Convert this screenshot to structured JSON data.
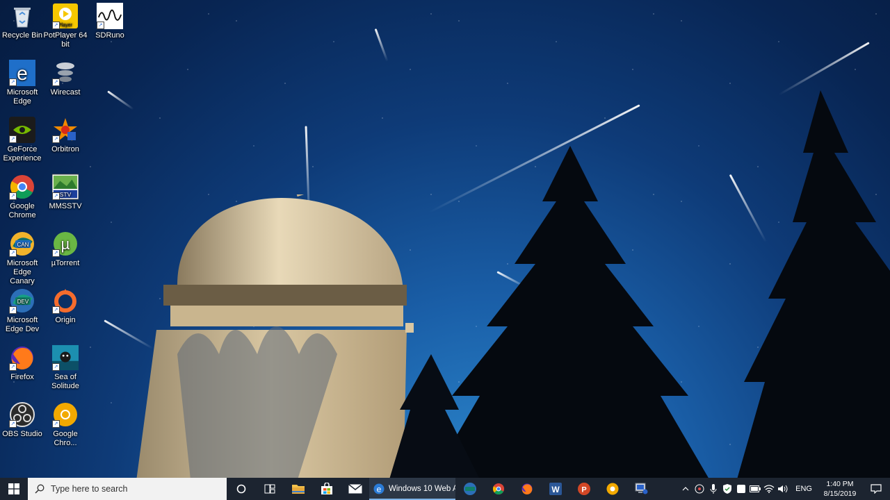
{
  "desktop_icons": [
    {
      "label": "Recycle Bin",
      "icon": "recycle-bin-icon"
    },
    {
      "label": "PotPlayer 64 bit",
      "icon": "potplayer-icon"
    },
    {
      "label": "SDRuno",
      "icon": "sdruno-icon"
    },
    {
      "label": "Microsoft Edge",
      "icon": "edge-icon"
    },
    {
      "label": "Wirecast",
      "icon": "wirecast-icon"
    },
    {
      "label": "GeForce Experience",
      "icon": "geforce-icon"
    },
    {
      "label": "Orbitron",
      "icon": "orbitron-icon"
    },
    {
      "label": "Google Chrome",
      "icon": "chrome-icon"
    },
    {
      "label": "MMSSTV",
      "icon": "mmsstv-icon"
    },
    {
      "label": "Microsoft Edge Canary",
      "icon": "edge-canary-icon"
    },
    {
      "label": "µTorrent",
      "icon": "utorrent-icon"
    },
    {
      "label": "Microsoft Edge Dev",
      "icon": "edge-dev-icon"
    },
    {
      "label": "Origin",
      "icon": "origin-icon"
    },
    {
      "label": "Firefox",
      "icon": "firefox-icon"
    },
    {
      "label": "Sea of Solitude",
      "icon": "sea-of-solitude-icon"
    },
    {
      "label": "OBS Studio",
      "icon": "obs-icon"
    },
    {
      "label": "Google Chro...",
      "icon": "chrome-canary-icon"
    }
  ],
  "taskbar": {
    "search_placeholder": "Type here to search",
    "active_window_label": "Windows 10 Web A...",
    "pinned": [
      "file-explorer-icon",
      "store-icon",
      "mail-icon",
      "edge-icon",
      "edge-dev-icon",
      "chrome-icon",
      "firefox-icon",
      "word-icon",
      "powerpoint-icon",
      "chrome-canary-icon",
      "network-app-icon"
    ],
    "language": "ENG",
    "time": "1:40 PM",
    "date": "8/15/2019"
  },
  "colors": {
    "taskbar_bg": "#1c2430",
    "accent": "#7fb4e8",
    "sky_top": "#061c40",
    "sky_bottom": "#2f8fd4"
  }
}
